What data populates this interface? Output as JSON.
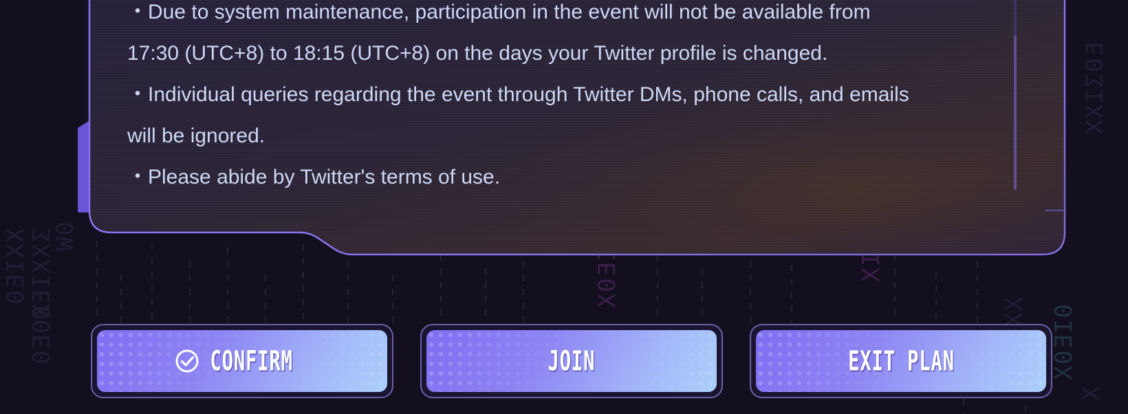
{
  "notice": {
    "lines": [
      "・Due to system maintenance, participation in the event will not be available from",
      "17:30 (UTC+8) to 18:15 (UTC+8) on the days your Twitter profile is changed.",
      "・Individual queries regarding the event through Twitter DMs, phone calls, and emails",
      "will be ignored.",
      "・Please abide by Twitter's terms of use."
    ]
  },
  "buttons": {
    "confirm_label": "CONFIRM",
    "confirm_icon": "check-circle-icon",
    "join_label": "JOIN",
    "exit_label": "EXIT PLAN"
  },
  "colors": {
    "background": "#140f1e",
    "panel_border": "#8a74f0",
    "text": "#cdd8f6",
    "button_gradient_start": "#7f6ef2",
    "button_gradient_end": "#acd0fb"
  }
}
